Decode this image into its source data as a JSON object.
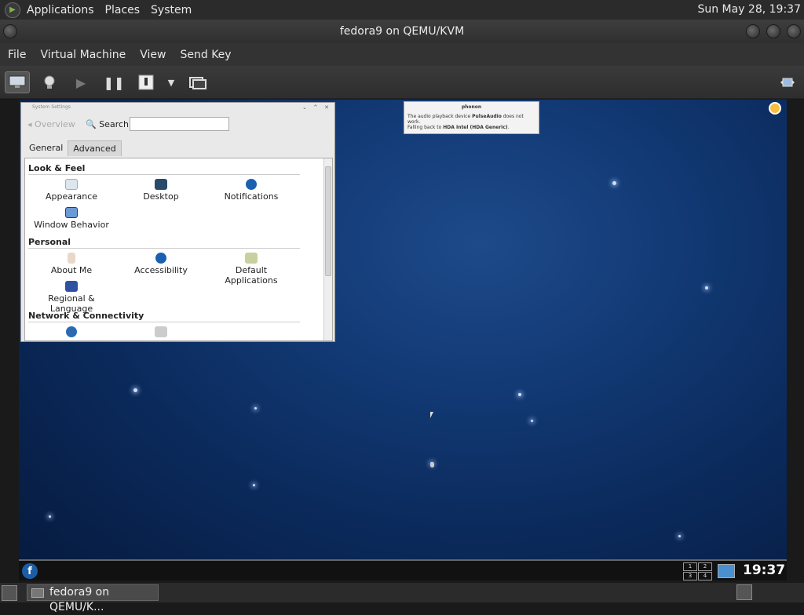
{
  "topbar": {
    "menus": [
      "Applications",
      "Places",
      "System"
    ],
    "clock": "Sun May 28, 19:37"
  },
  "window": {
    "title": "fedora9 on QEMU/KVM"
  },
  "menubar": {
    "items": [
      "File",
      "Virtual Machine",
      "View",
      "Send Key"
    ]
  },
  "toolbar": {
    "icons": [
      "console-icon",
      "details-icon",
      "run-icon",
      "pause-icon",
      "shutdown-icon",
      "dropdown-icon",
      "snapshot-icon",
      "fullscreen-icon"
    ]
  },
  "guest": {
    "settings": {
      "title": "System Settings",
      "overview": "Overview",
      "search_label": "Search:",
      "search_value": "",
      "tabs": [
        "General",
        "Advanced"
      ],
      "sections": [
        {
          "title": "Look & Feel",
          "items": [
            "Appearance",
            "Desktop",
            "Notifications",
            "Window Behavior"
          ]
        },
        {
          "title": "Personal",
          "items": [
            "About Me",
            "Accessibility",
            "Default Applications",
            "Regional & Language"
          ]
        },
        {
          "title": "Network & Connectivity",
          "items": []
        }
      ]
    },
    "notification": {
      "title": "phonon",
      "text_1": "The audio playback device ",
      "text_bold_1": "PulseAudio",
      "text_2": " does not work.",
      "text_3": "Falling back to ",
      "text_bold_2": "HDA Intel (HDA Generic)",
      "text_4": "."
    },
    "panel": {
      "pager": [
        "1",
        "2",
        "3",
        "4"
      ],
      "clock": "19:37"
    }
  },
  "taskbar": {
    "task_label": "fedora9 on QEMU/K..."
  }
}
